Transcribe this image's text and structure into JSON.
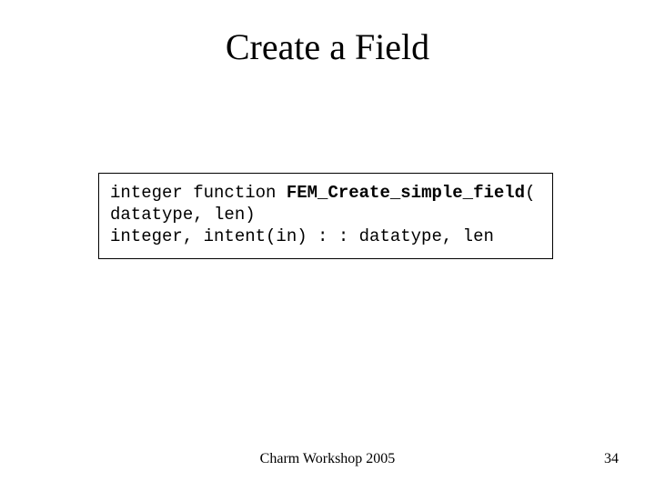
{
  "title": "Create a Field",
  "code": {
    "line1_prefix": "integer function ",
    "line1_bold": "FEM_Create_simple_field",
    "line1_suffix": "(",
    "line2": "datatype, len)",
    "line3": "integer, intent(in) : : datatype, len"
  },
  "footer": "Charm Workshop 2005",
  "page_number": "34"
}
